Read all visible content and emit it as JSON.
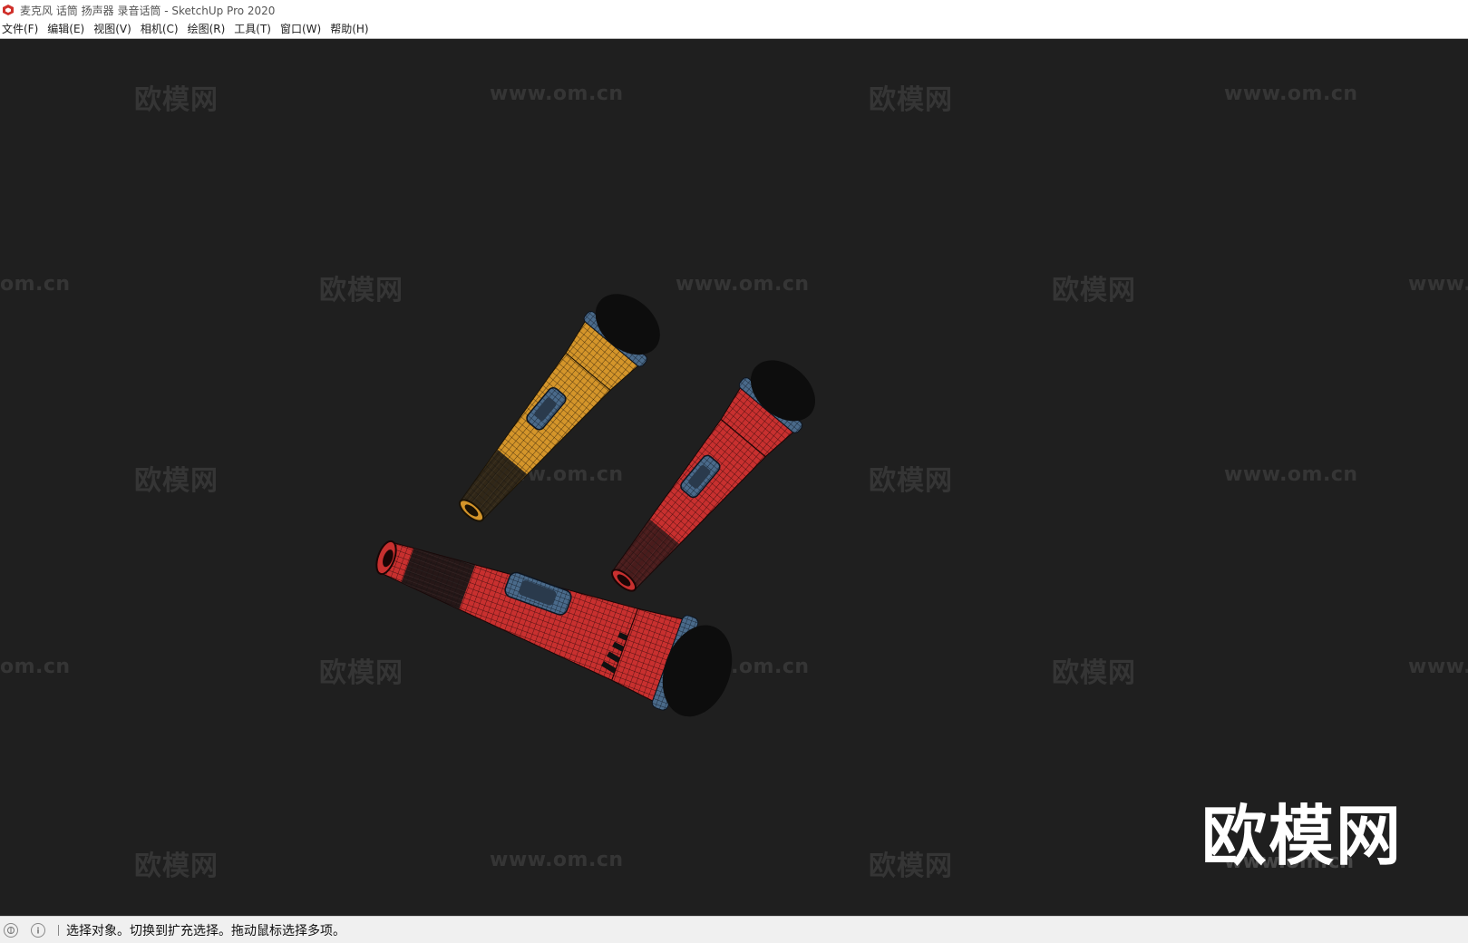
{
  "window": {
    "title": "麦克风 话筒 扬声器 录音话筒 - SketchUp Pro 2020",
    "icon": "sketchup-logo-icon"
  },
  "menu": [
    {
      "label": "文件(F)"
    },
    {
      "label": "编辑(E)"
    },
    {
      "label": "视图(V)"
    },
    {
      "label": "相机(C)"
    },
    {
      "label": "绘图(R)"
    },
    {
      "label": "工具(T)"
    },
    {
      "label": "窗口(W)"
    },
    {
      "label": "帮助(H)"
    }
  ],
  "watermarks": {
    "logo_text": "欧模网",
    "url_text": "www.om.cn",
    "url_partial_left": "om.cn",
    "url_partial_right": "www."
  },
  "brand_logo": {
    "text": "欧模网",
    "url": "www.om.cn"
  },
  "model": {
    "objects": [
      {
        "name": "yellow microphone",
        "body_color": "#d4952a",
        "grille_color": "#111111",
        "ring_color": "#4a6a8a"
      },
      {
        "name": "red microphone upright",
        "body_color": "#c8302f",
        "grille_color": "#111111",
        "ring_color": "#4a6a8a"
      },
      {
        "name": "red microphone lying",
        "body_color": "#c8302f",
        "grille_color": "#111111",
        "ring_color": "#4a6a8a"
      }
    ]
  },
  "status": {
    "message": "选择对象。切换到扩充选择。拖动鼠标选择多项。",
    "icons": [
      "geo-location-icon",
      "info-icon"
    ]
  }
}
